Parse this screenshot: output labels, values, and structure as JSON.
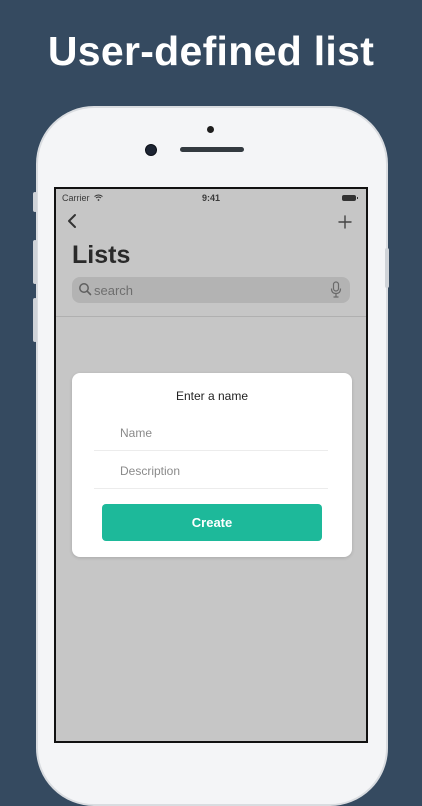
{
  "headline": "User-defined list",
  "statusbar": {
    "carrier": "Carrier",
    "time": "9:41"
  },
  "nav": {
    "back_icon": "chevron-left-icon",
    "add_icon": "plus-icon"
  },
  "page": {
    "title": "Lists"
  },
  "search": {
    "placeholder": "search",
    "icon": "search-icon",
    "mic_icon": "microphone-icon"
  },
  "modal": {
    "title": "Enter a name",
    "name_placeholder": "Name",
    "description_placeholder": "Description",
    "create_label": "Create"
  },
  "colors": {
    "background": "#354a60",
    "accent": "#1db99a",
    "screen_overlay": "#c6c6c6"
  }
}
